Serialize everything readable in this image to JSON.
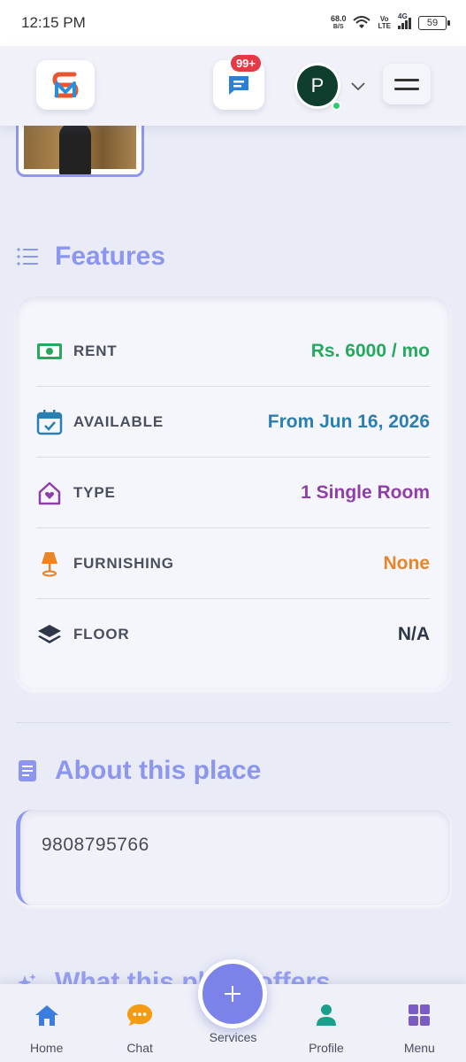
{
  "status_bar": {
    "time": "12:15 PM",
    "net_speed_value": "68.0",
    "net_speed_unit": "B/S",
    "volte_top": "Vo",
    "volte_bottom": "LTE",
    "network": "4G",
    "battery": "59"
  },
  "header": {
    "chat_badge": "99+",
    "avatar_initial": "P"
  },
  "features": {
    "title": "Features",
    "rows": [
      {
        "label": "RENT",
        "value": "Rs. 6000 / mo",
        "icon": "cash-icon",
        "color": "#27a85f"
      },
      {
        "label": "AVAILABLE",
        "value": "From Jun 16, 2026",
        "icon": "calendar-check-icon",
        "color": "#2b7fb0"
      },
      {
        "label": "TYPE",
        "value": "1 Single Room",
        "icon": "house-heart-icon",
        "color": "#8e3fa8"
      },
      {
        "label": "FURNISHING",
        "value": "None",
        "icon": "lamp-icon",
        "color": "#e8852a"
      },
      {
        "label": "FLOOR",
        "value": "N/A",
        "icon": "layers-icon",
        "color": "#2d3748"
      }
    ]
  },
  "about": {
    "title": "About this place",
    "text": "9808795766"
  },
  "offers": {
    "title": "What this place offers"
  },
  "bottom_nav": {
    "home": "Home",
    "chat": "Chat",
    "services": "Services",
    "profile": "Profile",
    "menu": "Menu"
  },
  "colors": {
    "accent": "#8c96ef",
    "fab": "#7b83e9",
    "nav_blue": "#3b7ddd",
    "chat_orange": "#f39c12",
    "profile_teal": "#1aa08a",
    "menu_purple": "#7b5bc4"
  }
}
